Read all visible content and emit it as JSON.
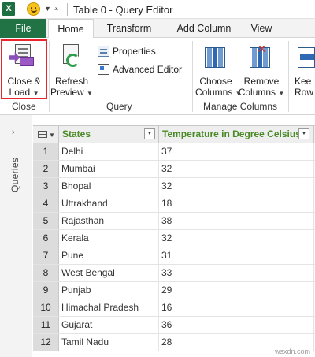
{
  "titlebar": {
    "app_icon": "excel-logo",
    "app_letter": "X",
    "title": "Table 0 - Query Editor"
  },
  "tabs": [
    {
      "label": "File"
    },
    {
      "label": "Home"
    },
    {
      "label": "Transform"
    },
    {
      "label": "Add Column"
    },
    {
      "label": "View"
    }
  ],
  "ribbon": {
    "close_group": {
      "label": "Close",
      "close_load": {
        "line1": "Close &",
        "line2": "Load"
      }
    },
    "query_group": {
      "label": "Query",
      "refresh": {
        "line1": "Refresh",
        "line2": "Preview"
      },
      "properties": "Properties",
      "advanced_editor": "Advanced Editor"
    },
    "manage_columns_group": {
      "label": "Manage Columns",
      "choose": {
        "line1": "Choose",
        "line2": "Columns"
      },
      "remove": {
        "line1": "Remove",
        "line2": "Columns"
      }
    },
    "keep_rows": {
      "line1": "Kee",
      "line2": "Row"
    }
  },
  "queries_pane": {
    "label": "Queries",
    "chevron": "›"
  },
  "grid": {
    "columns": [
      {
        "name": "States"
      },
      {
        "name": "Temperature in Degree Celsius"
      }
    ],
    "rows": [
      {
        "idx": "1",
        "state": "Delhi",
        "temp": "37"
      },
      {
        "idx": "2",
        "state": "Mumbai",
        "temp": "32"
      },
      {
        "idx": "3",
        "state": "Bhopal",
        "temp": "32"
      },
      {
        "idx": "4",
        "state": "Uttrakhand",
        "temp": "18"
      },
      {
        "idx": "5",
        "state": "Rajasthan",
        "temp": "38"
      },
      {
        "idx": "6",
        "state": "Kerala",
        "temp": "32"
      },
      {
        "idx": "7",
        "state": "Pune",
        "temp": "31"
      },
      {
        "idx": "8",
        "state": "West Bengal",
        "temp": "33"
      },
      {
        "idx": "9",
        "state": "Punjab",
        "temp": "29"
      },
      {
        "idx": "10",
        "state": "Himachal Pradesh",
        "temp": "16"
      },
      {
        "idx": "11",
        "state": "Gujarat",
        "temp": "36"
      },
      {
        "idx": "12",
        "state": "Tamil Nadu",
        "temp": "28"
      }
    ]
  },
  "watermark": "wsxdn.com",
  "colors": {
    "file_tab": "#217346",
    "highlight_border": "#e8262b",
    "header_text": "#4a8a26"
  }
}
